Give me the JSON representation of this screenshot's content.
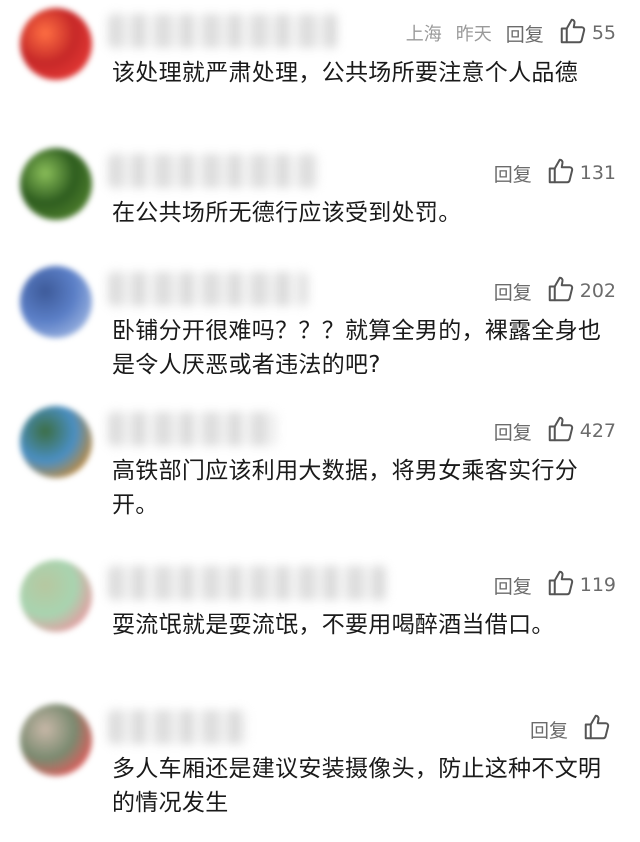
{
  "comments": [
    {
      "location": "上海",
      "time": "昨天",
      "reply": "回复",
      "likes": "55",
      "text": "该处理就严肃处理，公共场所要注意个人品德",
      "avatar_colors": [
        "#c62828",
        "#e53935",
        "#ff7043"
      ]
    },
    {
      "location": "",
      "time": "",
      "reply": "回复",
      "likes": "131",
      "text": "在公共场所无德行应该受到处罚。",
      "avatar_colors": [
        "#2e5d1f",
        "#4f7f2d",
        "#8bbf5a"
      ]
    },
    {
      "location": "",
      "time": "",
      "reply": "回复",
      "likes": "202",
      "text": "卧铺分开很难吗？？？就算全男的，裸露全身也是令人厌恶或者违法的吧?",
      "avatar_colors": [
        "#5b7fc7",
        "#9bb3e0",
        "#3d5a99"
      ]
    },
    {
      "location": "",
      "time": "",
      "reply": "回复",
      "likes": "427",
      "text": "高铁部门应该利用大数据，将男女乘客实行分开。",
      "avatar_colors": [
        "#4a8fc4",
        "#c48a3a",
        "#3c6e44"
      ]
    },
    {
      "location": "",
      "time": "",
      "reply": "回复",
      "likes": "119",
      "text": "耍流氓就是耍流氓，不要用喝醉酒当借口。",
      "avatar_colors": [
        "#a8d4b0",
        "#e79aa0",
        "#b7c7a0"
      ]
    },
    {
      "location": "",
      "time": "",
      "reply": "回复",
      "likes": "",
      "text": "多人车厢还是建议安装摄像头，防止这种不文明的情况发生",
      "avatar_colors": [
        "#7a8a70",
        "#e35a5a",
        "#c8b8a8"
      ]
    }
  ]
}
